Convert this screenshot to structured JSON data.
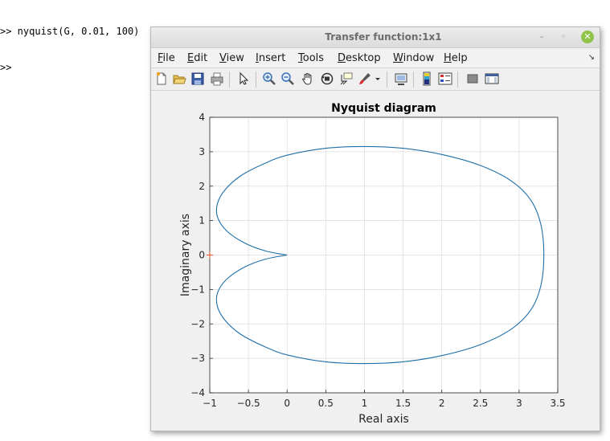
{
  "console": {
    "lines": [
      ">> nyquist(G, 0.01, 100)",
      ">>"
    ]
  },
  "window": {
    "title": "Transfer function:1x1",
    "controls": {
      "minimize": "–",
      "maximize": "◦",
      "close": "✕"
    }
  },
  "menu": {
    "items": [
      "File",
      "Edit",
      "View",
      "Insert",
      "Tools",
      "Desktop",
      "Window",
      "Help"
    ],
    "overflow_arrow": "↘"
  },
  "toolbar": {
    "icons": [
      "new-figure-icon",
      "open-file-icon",
      "save-icon",
      "print-icon",
      "pointer-icon",
      "zoom-in-icon",
      "zoom-out-icon",
      "pan-hand-icon",
      "rotate-3d-icon",
      "data-cursor-icon",
      "brush-icon",
      "dropdown-arrow-icon",
      "link-plot-icon",
      "colorbar-icon",
      "legend-icon",
      "hide-plot-tools-icon",
      "show-plot-tools-icon"
    ]
  },
  "chart_data": {
    "type": "line",
    "title": "Nyquist diagram",
    "xlabel": "Real axis",
    "ylabel": "Imaginary axis",
    "xlim": [
      -1,
      3.5
    ],
    "ylim": [
      -4,
      4
    ],
    "xticks": [
      "-1",
      "-0.5",
      "0",
      "0.5",
      "1",
      "1.5",
      "2",
      "2.5",
      "3",
      "3.5"
    ],
    "yticks": [
      "4",
      "3",
      "2",
      "1",
      "0",
      "-1",
      "-2",
      "-3",
      "-4"
    ],
    "grid": true,
    "series": [
      {
        "color": "#1f6fa8",
        "x": [
          0.0,
          -0.28,
          -0.55,
          -0.78,
          -0.9,
          -0.9,
          -0.8,
          -0.6,
          -0.3,
          0.0,
          0.5,
          1.0,
          1.5,
          2.0,
          2.5,
          2.9,
          3.15,
          3.28,
          3.32,
          3.28,
          3.15,
          2.9,
          2.5,
          2.0,
          1.5,
          1.0,
          0.5,
          0.0,
          -0.3,
          -0.6,
          -0.8,
          -0.9,
          -0.9,
          -0.78,
          -0.55,
          -0.28,
          0.0
        ],
        "y": [
          0.0,
          -0.12,
          -0.35,
          -0.7,
          -1.1,
          -1.5,
          -1.9,
          -2.3,
          -2.65,
          -2.9,
          -3.1,
          -3.15,
          -3.1,
          -2.92,
          -2.6,
          -2.15,
          -1.6,
          -0.9,
          0.0,
          0.9,
          1.6,
          2.15,
          2.6,
          2.92,
          3.1,
          3.15,
          3.1,
          2.9,
          2.65,
          2.3,
          1.9,
          1.5,
          1.1,
          0.7,
          0.35,
          0.12,
          0.0
        ]
      }
    ],
    "critical_point": {
      "x": -1,
      "y": 0,
      "color": "#e05020"
    }
  }
}
